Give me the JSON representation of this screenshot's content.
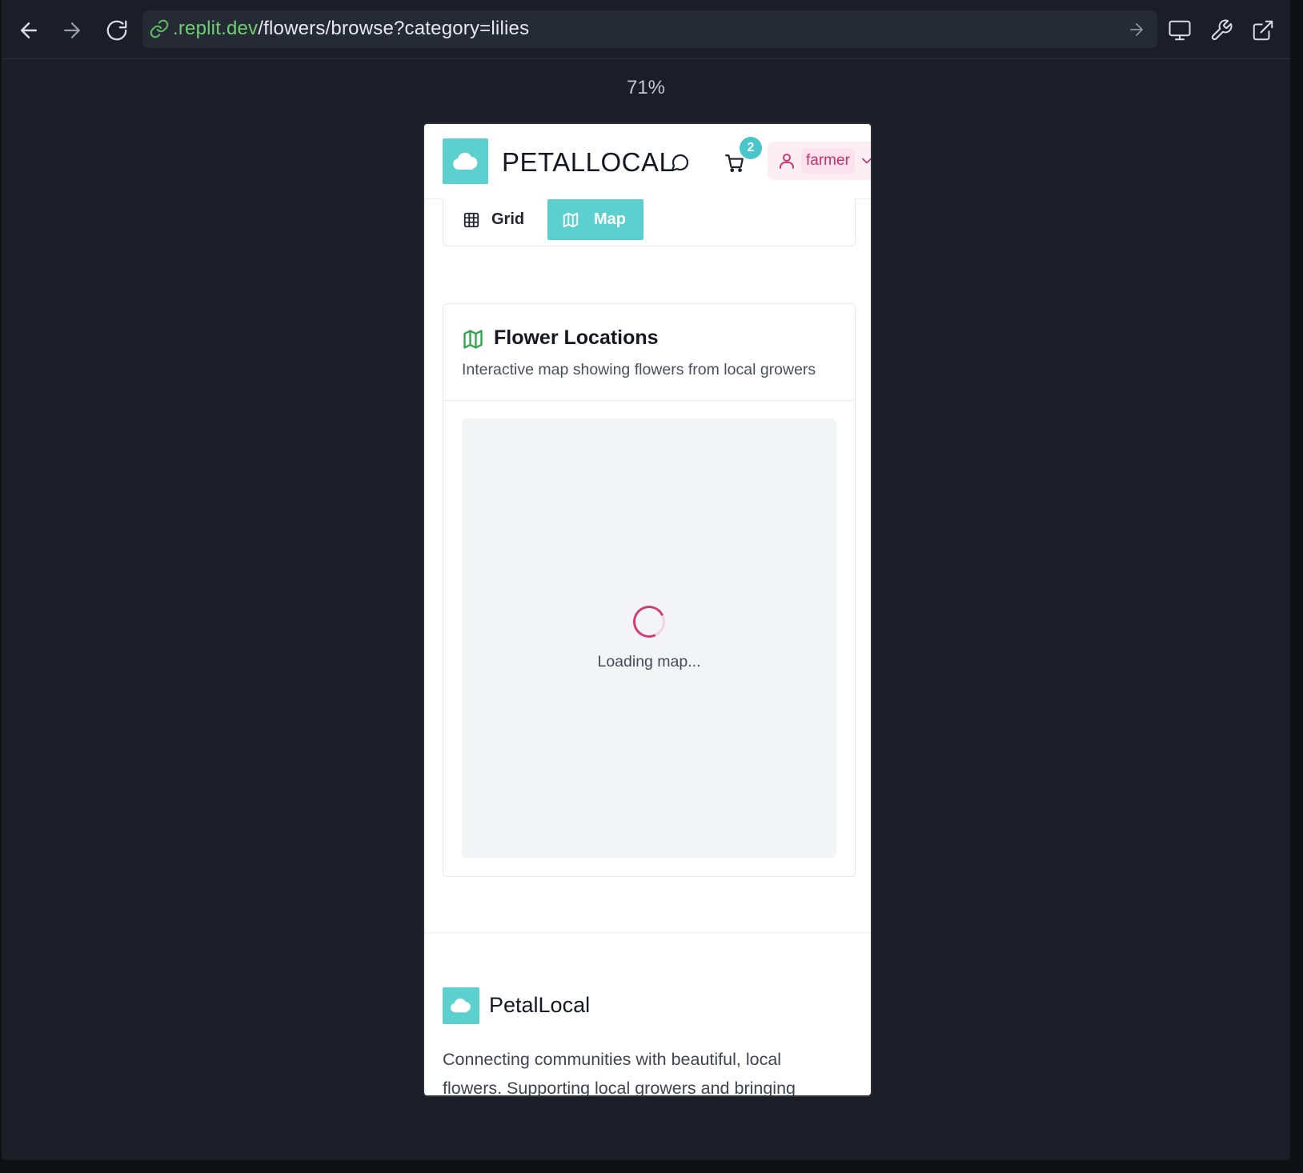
{
  "browser": {
    "url_domain": ".replit.dev",
    "url_path": "/flowers/browse?category=lilies",
    "zoom": "71%"
  },
  "app": {
    "brand": "PETALLOCAL",
    "cart_count": "2",
    "user_name": "farmer",
    "accent_color": "#5ccfcf",
    "user_color": "#c2346e"
  },
  "view_toggle": {
    "grid_label": "Grid",
    "map_label": "Map",
    "selected": "Map"
  },
  "locations": {
    "title": "Flower Locations",
    "subtitle": "Interactive map showing flowers from local growers",
    "loading_text": "Loading map..."
  },
  "footer": {
    "brand": "PetalLocal",
    "description": "Connecting communities with beautiful, local flowers. Supporting local growers and bringing"
  }
}
